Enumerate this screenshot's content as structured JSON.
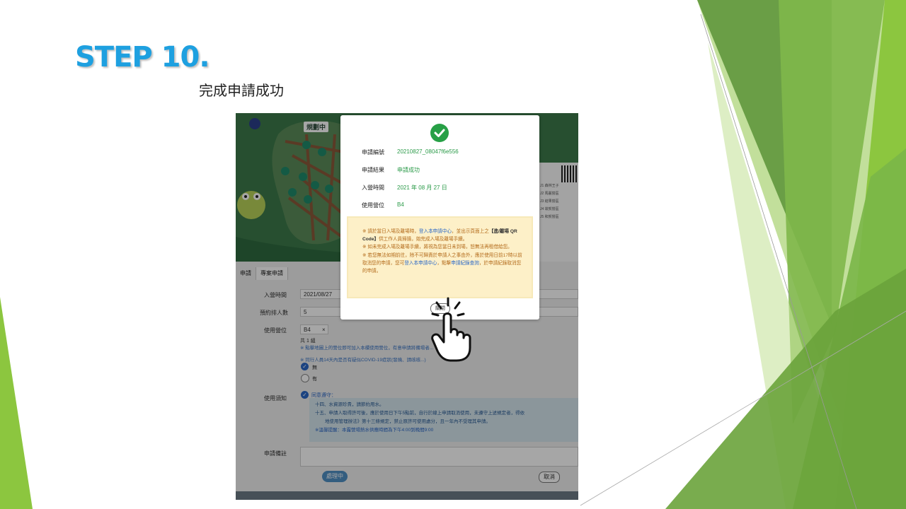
{
  "slide": {
    "title": "STEP 10.",
    "subtitle": "完成申請成功"
  },
  "map": {
    "label": "規劃中",
    "side_lines": [
      "J1 森林王子",
      "J2 馬麗營區",
      "J3 結果營區",
      "J4 竣賀營區",
      "J5 和賀營區"
    ]
  },
  "form": {
    "tabs": [
      "申請",
      "專案申請"
    ],
    "date_label": "入營時間",
    "date_value": "2021/08/27",
    "people_label": "預約排人數",
    "people_value": "5",
    "camp_label": "使用營位",
    "camp_value": "B4",
    "camp_tag_close": "×",
    "group_count": "共 1 組",
    "camp_hint": "※ 點擊地圖上的營位即可加入本欄使用營位，有意申請將備場者...",
    "covid_question": "※ 同行人員14天內是否有疑似COVID-19症狀(發燒、請咳咳...)",
    "option_no": "無",
    "option_yes": "有",
    "notice_label": "使用須知",
    "agree_text": "同意遵守：",
    "notice_lines": [
      "十四、水資源珍貴，請節約用水。",
      "十五、申請人取得許可後，應於使用日下午5點前，自行於線上申請取消使用，未遵守上述規定者，得依",
      "地使用管理辦法》第十三條規定，禁止原許可使用處分，且一年內不受理其申請。",
      "※溫馨提醒：本露營場熱水供應時間為下午4:00到晚間9:00"
    ],
    "remark_label": "申請備註",
    "submit_label": "處理中",
    "cancel_label": "取消"
  },
  "modal": {
    "rows": [
      {
        "label": "申請編號",
        "value": "20210827_08047f6e556"
      },
      {
        "label": "申請結果",
        "value": "申請成功"
      },
      {
        "label": "入營時間",
        "value": "2021 年 08 月 27 日"
      },
      {
        "label": "使用營位",
        "value": "B4"
      }
    ],
    "notice": {
      "p1_a": "※ 請於當日入場及離場時，",
      "p1_link": "登入本申請中心",
      "p1_b": "，並出示頁面上之",
      "p1_qr": "【進/離場 QR Code】",
      "p1_c": "供工作人員掃描，始完成入場及離場手續。",
      "p2": "※ 如未完成入場及離場手續，將視為您當日未到場，恕無法再租借給您。",
      "p3_a": "※ 若您無法如期前往，除不可歸責於申請人之事由外，應於使用日前17時以前取消您的申請，您可",
      "p3_link1": "登入本申請中心",
      "p3_b": "，點擊",
      "p3_link2": "申請紀錄查詢",
      "p3_c": "，於申請紀錄取消您的申請。"
    },
    "close_label": "關閉"
  },
  "colors": {
    "title_blue": "#1ea0e0",
    "success_green": "#27a046",
    "slide_green": "#8bc34a"
  },
  "icons": [
    "check-circle-icon",
    "hand-pointer-icon",
    "frog-icon",
    "qr-code-icon"
  ]
}
